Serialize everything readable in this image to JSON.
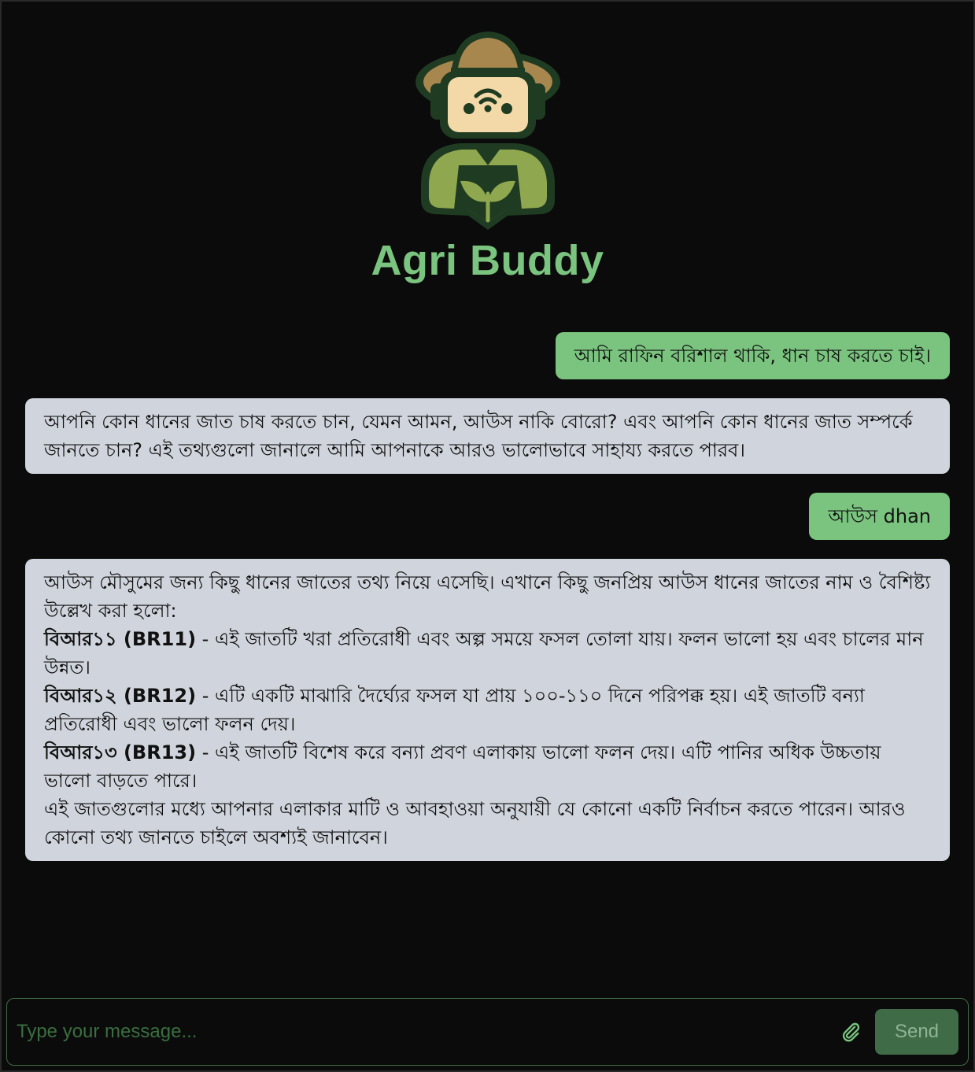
{
  "header": {
    "logo_icon": "farmer-robot-logo-icon",
    "title": "Agri Buddy"
  },
  "chat": {
    "messages": [
      {
        "role": "user",
        "text": "আমি রাফিন বরিশাল থাকি, ধান চাষ করতে চাই।"
      },
      {
        "role": "bot",
        "text": "আপনি কোন ধানের জাত চাষ করতে চান, যেমন আমন, আউস নাকি বোরো? এবং আপনি কোন ধানের জাত সম্পর্কে জানতে চান? এই তথ্যগুলো জানালে আমি আপনাকে আরও ভালোভাবে সাহায্য করতে পারব।"
      },
      {
        "role": "user",
        "text": "আউস dhan"
      },
      {
        "role": "bot",
        "intro": "আউস মৌসুমের জন্য কিছু ধানের জাতের তথ্য নিয়ে এসেছি। এখানে কিছু জনপ্রিয় আউস ধানের জাতের নাম ও বৈশিষ্ট্য উল্লেখ করা হলো:",
        "varieties": [
          {
            "name": "বিআর১১ (BR11)",
            "desc": " - এই জাতটি খরা প্রতিরোধী এবং অল্প সময়ে ফসল তোলা যায়। ফলন ভালো হয় এবং চালের মান উন্নত।"
          },
          {
            "name": "বিআর১২ (BR12)",
            "desc": " - এটি একটি মাঝারি দৈর্ঘ্যের ফসল যা প্রায় ১০০-১১০ দিনে পরিপক্ক হয়। এই জাতটি বন্যা প্রতিরোধী এবং ভালো ফলন দেয়।"
          },
          {
            "name": "বিআর১৩ (BR13)",
            "desc": " - এই জাতটি বিশেষ করে বন্যা প্রবণ এলাকায় ভালো ফলন দেয়। এটি পানির অধিক উচ্চতায় ভালো বাড়তে পারে।"
          }
        ],
        "outro": "এই জাতগুলোর মধ্যে আপনার এলাকার মাটি ও আবহাওয়া অনুযায়ী যে কোনো একটি নির্বাচন করতে পারেন। আরও কোনো তথ্য জানতে চাইলে অবশ্যই জানাবেন।"
      }
    ]
  },
  "composer": {
    "placeholder": "Type your message...",
    "attach_icon": "paperclip-icon",
    "send_label": "Send"
  },
  "colors": {
    "background": "#0b0b0b",
    "accent_green": "#7ac47f",
    "bot_bubble": "#d0d5dd",
    "send_button": "#3f6b46"
  }
}
